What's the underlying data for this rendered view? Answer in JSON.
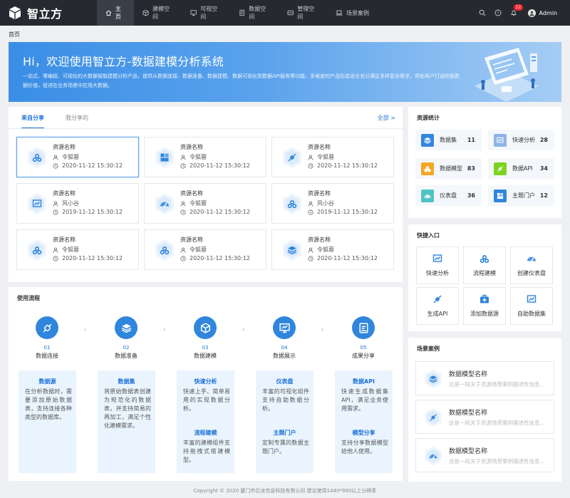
{
  "app": {
    "name": "智立方",
    "user": "Admin",
    "notifications": "12"
  },
  "nav": [
    {
      "label": "主页",
      "icon": "home-icon"
    },
    {
      "label": "建模空间",
      "icon": "cube-icon"
    },
    {
      "label": "可视空间",
      "icon": "monitor-icon"
    },
    {
      "label": "数据空间",
      "icon": "document-icon"
    },
    {
      "label": "管理空间",
      "icon": "server-icon"
    },
    {
      "label": "场景案例",
      "icon": "laptop-icon"
    }
  ],
  "breadcrumb": "首页",
  "banner": {
    "title": "Hi，欢迎使用智立方-数据建模分析系统",
    "description": "一站式、零编程、可视化的大数据智能建模分析产品，提供从数据连接、数据准备、数据建模、数据可视化到数据API服务等功能，多维度的产品形态适合充分满足多样复杂需求，帮助客户打通挖掘数据价值，促进在业务场景中应用大数据。"
  },
  "share": {
    "tabs": [
      "来自分享",
      "我分享的"
    ],
    "more": "全部 >",
    "items": [
      {
        "name": "资源名称",
        "user": "令狐蓉",
        "time": "2020-11-12 15:30:12",
        "icon": "model-icon"
      },
      {
        "name": "资源名称",
        "user": "令狐蓉",
        "time": "2020-11-12 15:30:12",
        "icon": "portal-icon"
      },
      {
        "name": "资源名称",
        "user": "令狐蓉",
        "time": "2020-11-12 15:30:12",
        "icon": "connect-icon"
      },
      {
        "name": "资源名称",
        "user": "风小谷",
        "time": "2019-11-12 15:30:12",
        "icon": "chart-icon"
      },
      {
        "name": "资源名称",
        "user": "令狐蓉",
        "time": "2020-11-12 15:30:12",
        "icon": "gauge-icon"
      },
      {
        "name": "资源名称",
        "user": "风小谷",
        "time": "2019-11-12 15:30:12",
        "icon": "model-icon"
      },
      {
        "name": "资源名称",
        "user": "令狐蓉",
        "time": "2020-11-12 15:30:12",
        "icon": "model-icon"
      },
      {
        "name": "资源名称",
        "user": "令狐蓉",
        "time": "2020-11-12 15:30:12",
        "icon": "model-icon"
      },
      {
        "name": "资源名称",
        "user": "令狐蓉",
        "time": "2020-11-12 15:30:12",
        "icon": "layers-icon"
      }
    ]
  },
  "flow": {
    "title": "使用流程",
    "steps": [
      {
        "num": "01",
        "name": "数据连接",
        "icon": "plug-icon"
      },
      {
        "num": "02",
        "name": "数据准备",
        "icon": "layers-icon"
      },
      {
        "num": "03",
        "name": "数据建模",
        "icon": "cube-icon"
      },
      {
        "num": "04",
        "name": "数据展示",
        "icon": "monitor-icon"
      },
      {
        "num": "05",
        "name": "成果分享",
        "icon": "share-icon"
      }
    ],
    "arrow": "›",
    "details": [
      {
        "h1": "数据源",
        "t1": "在分析数据时，需要添加原始数据表，支持连接各种类型的数据库。"
      },
      {
        "h1": "数据集",
        "t1": "将原始数据表创建为规范化的数据表，并支持简易的再加工，满足个性化建模需求。"
      },
      {
        "h1": "快速分析",
        "t1": "快速上手、简单易用的实现数据分析。",
        "h2": "流程建模",
        "t2": "丰富的建模组件支持拖拽式搭建模型。"
      },
      {
        "h1": "仪表盘",
        "t1": "丰富的可视化组件支持自助数据分析。",
        "h2": "主题门户",
        "t2": "定制专属的数据主题门户。"
      },
      {
        "h1": "数据API",
        "t1": "快速生成数据集API，满足业务使用需求。",
        "h2": "模型分享",
        "t2": "支持分享数据模型给他人使用。"
      }
    ]
  },
  "stats": {
    "title": "资源统计",
    "items": [
      {
        "label": "数据集",
        "value": "11",
        "color": "#2f86dc",
        "icon": "layers-icon"
      },
      {
        "label": "快速分析",
        "value": "28",
        "color": "#8fb3e6",
        "icon": "chart-icon"
      },
      {
        "label": "数据模型",
        "value": "83",
        "color": "#f5a623",
        "icon": "model-icon"
      },
      {
        "label": "数据API",
        "value": "34",
        "color": "#7ed321",
        "icon": "connect-icon"
      },
      {
        "label": "仪表盘",
        "value": "36",
        "color": "#50c4c4",
        "icon": "gauge-icon"
      },
      {
        "label": "主题门户",
        "value": "12",
        "color": "#2f86dc",
        "icon": "portal-icon"
      }
    ]
  },
  "quick": {
    "title": "快捷入口",
    "items": [
      {
        "label": "快速分析",
        "icon": "chart-icon"
      },
      {
        "label": "流程建模",
        "icon": "model-icon"
      },
      {
        "label": "创建仪表盘",
        "icon": "gauge-icon"
      },
      {
        "label": "生成API",
        "icon": "connect-icon"
      },
      {
        "label": "添加数据源",
        "icon": "medkit-icon"
      },
      {
        "label": "自助数据集",
        "icon": "chart-icon"
      }
    ]
  },
  "cases": {
    "title": "场景案例",
    "items": [
      {
        "name": "数据模型名称",
        "desc": "这是一段关于资源场景案例描述性信息...",
        "icon": "layers-icon"
      },
      {
        "name": "数据模型名称",
        "desc": "这是一段关于资源场景案例描述性信息...",
        "icon": "connect-icon"
      },
      {
        "name": "数据模型名称",
        "desc": "这是一段关于资源场景案例描述性信息...",
        "icon": "gauge-icon"
      }
    ]
  },
  "footer": "Copyright © 2020  厦门市巨龙信息科技有限公司  建议使用1440*900以上分辨率"
}
